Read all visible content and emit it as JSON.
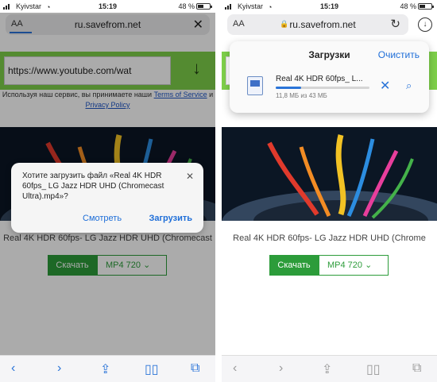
{
  "left": {
    "status": {
      "carrier": "Kyivstar",
      "time": "15:19",
      "battery": "48 %"
    },
    "urlbar": {
      "aa": "AA",
      "url": "ru.savefrom.net"
    },
    "page": {
      "input_value": "https://www.youtube.com/wat",
      "terms_prefix": "Используя наш сервис, вы принимаете наши",
      "terms_link": "Terms of Service",
      "terms_and": "и",
      "privacy_link": "Privacy Policy",
      "video_title": "Real 4K HDR 60fps- LG Jazz HDR UHD (Chromecast",
      "download_label": "Скачать",
      "format_label": "MP4  720"
    },
    "dialog": {
      "message": "Хотите загрузить файл «Real 4K HDR 60fps_ LG Jazz HDR UHD (Chromecast Ultra).mp4»?",
      "view_label": "Смотреть",
      "download_label": "Загрузить"
    }
  },
  "right": {
    "status": {
      "carrier": "Kyivstar",
      "time": "15:19",
      "battery": "48 %"
    },
    "urlbar": {
      "aa": "AA",
      "url": "ru.savefrom.net"
    },
    "downloads": {
      "title": "Загрузки",
      "clear_label": "Очистить",
      "file_name": "Real 4K HDR 60fps_ L...",
      "file_size": "11,8 МБ из 43 МБ",
      "progress": 0.27
    },
    "page": {
      "video_title": "Real 4K HDR 60fps- LG Jazz HDR UHD (Chrome",
      "download_label": "Скачать",
      "format_label": "MP4  720"
    }
  },
  "colors": {
    "accent": "#2a74d8",
    "green_bar": "#7ed04a",
    "download_green": "#2c9c3a"
  }
}
